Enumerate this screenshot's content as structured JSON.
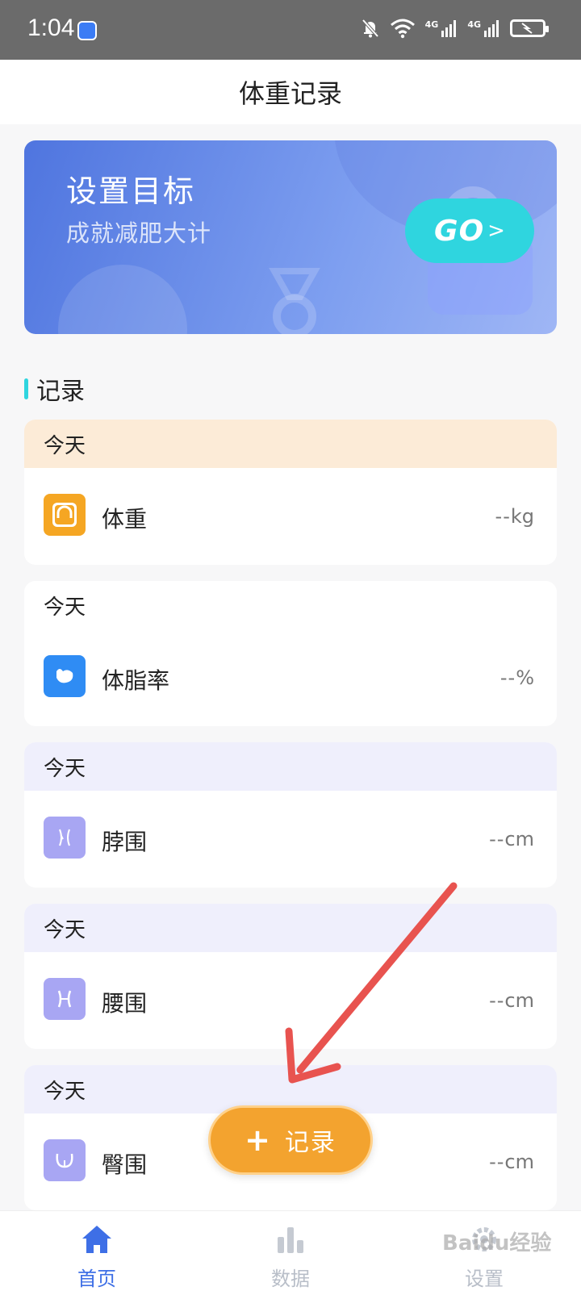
{
  "status_bar": {
    "time": "1:04",
    "network_1": "4G",
    "network_2": "4G"
  },
  "header": {
    "title": "体重记录"
  },
  "banner": {
    "title": "设置目标",
    "subtitle": "成就减肥大计",
    "button_label": "GO",
    "button_arrow": ">",
    "button_color": "#2fd5df"
  },
  "section": {
    "title": "记录"
  },
  "records": [
    {
      "date": "今天",
      "name": "体重",
      "value": "--",
      "unit": "kg",
      "icon": "scale-icon",
      "icon_color": "#f5a623",
      "header_bg": "#fcebd7"
    },
    {
      "date": "今天",
      "name": "体脂率",
      "value": "--",
      "unit": "%",
      "icon": "muscle-icon",
      "icon_color": "#2f8cf4",
      "header_bg": "#ffffff"
    },
    {
      "date": "今天",
      "name": "脖围",
      "value": "--",
      "unit": "cm",
      "icon": "neck-icon",
      "icon_color": "#a8a6f3",
      "header_bg": "#efeffc"
    },
    {
      "date": "今天",
      "name": "腰围",
      "value": "--",
      "unit": "cm",
      "icon": "waist-icon",
      "icon_color": "#a8a6f3",
      "header_bg": "#efeffc"
    },
    {
      "date": "今天",
      "name": "臀围",
      "value": "--",
      "unit": "cm",
      "icon": "hip-icon",
      "icon_color": "#a8a6f3",
      "header_bg": "#efeffc"
    }
  ],
  "fab": {
    "plus": "+",
    "label": "记录",
    "color": "#f3a32f"
  },
  "tabs": [
    {
      "label": "首页",
      "icon": "home-icon",
      "active": true
    },
    {
      "label": "数据",
      "icon": "bar-chart-icon",
      "active": false
    },
    {
      "label": "设置",
      "icon": "settings-icon",
      "active": false
    }
  ],
  "watermark": {
    "text": "Baidu经验"
  },
  "colors": {
    "active_tab": "#3e6fe6",
    "inactive_tab": "#b8bec8",
    "annotation_arrow": "#e8534f"
  }
}
